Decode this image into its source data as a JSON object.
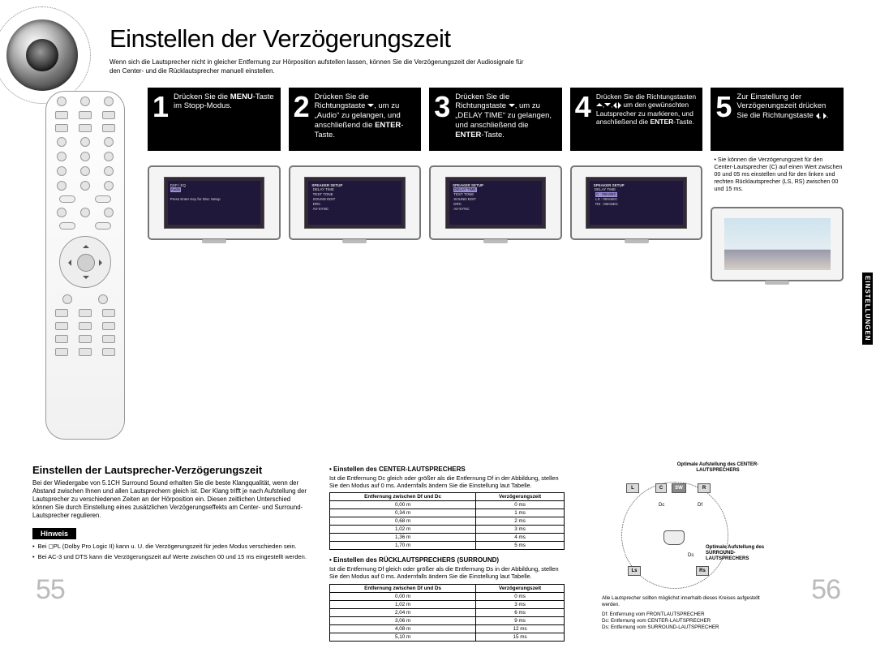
{
  "title": "Einstellen der Verzögerungszeit",
  "intro": "Wenn sich die Lautsprecher nicht in gleicher Entfernung zur Hörposition aufstellen lassen, können Sie die Verzögerungszeit der Audiosignale für den Center- und die Rücklautsprecher manuell einstellen.",
  "side_label": "EINSTELLUNGEN",
  "page_left": "55",
  "page_right": "56",
  "steps": {
    "s1": {
      "num": "1",
      "text_pre": "Drücken Sie die ",
      "bold": "MENU",
      "text_post": "-Taste im Stopp-Modus."
    },
    "s2": {
      "num": "2",
      "line1": "Drücken Sie die Richtungstaste ",
      "line2": ", um zu „Audio“ zu gelangen, und anschließend die ",
      "enter": "ENTER",
      "tail": "-Taste."
    },
    "s3": {
      "num": "3",
      "line1": "Drücken Sie die Richtungstaste ",
      "line2": ", um zu „DELAY TIME“ zu gelangen, und anschließend die ",
      "enter": "ENTER",
      "tail": "-Taste."
    },
    "s4": {
      "num": "4",
      "line1": "Drücken Sie die Richtungstasten ",
      "line2": " um den gewünschten Lautsprecher zu markieren, und anschließend die ",
      "enter": "ENTER",
      "tail": "-Taste."
    },
    "s5": {
      "num": "5",
      "text": "Zur Einstellung der Verzögerungszeit drücken Sie die Richtungstaste ",
      "tail": "."
    },
    "note5": "Sie können die Verzögerungszeit für den Center-Lautsprecher (C) auf einen Wert zwischen 00 und 05 ms einstellen und für den linken und rechten Rücklautsprecher (LS, RS) zwischen 00 und 15 ms."
  },
  "tv_labels": {
    "hint": "Press Enter Key for Disc Setup",
    "menu1": "DSP / EQ",
    "audio": "Audio",
    "spk_setup": "SPEAKER SETUP",
    "delay": "DELAY TIME",
    "test": "TEST TONE",
    "sound": "SOUND EDIT",
    "drc": "DRC",
    "avsync": "AV-SYNC",
    "c": "C : 00mSEC",
    "ls": "LS : 00mSEC",
    "rs": "RS : 00mSEC"
  },
  "bottom": {
    "sub_title": "Einstellen der Lautsprecher-Verzögerungszeit",
    "sub_body": "Bei der Wiedergabe von 5.1CH Surround Sound erhalten Sie die beste Klangqualität, wenn der Abstand zwischen Ihnen und allen Lautsprechern gleich ist. Der Klang trifft je nach Aufstellung der Lautsprecher zu verschiedenen Zeiten an der Hörposition ein. Diesen zeitlichen Unterschied können Sie durch Einstellung eines zusätzlichen Verzögerungseffekts am Center- und Surround-Lautsprecher regulieren.",
    "hinweis": "Hinweis",
    "hin1": "Bei  ◻PL (Dolby Pro Logic II) kann u. U. die Verzögerungszeit für jeden Modus verschieden sein.",
    "hin2": "Bei AC-3 und DTS kann die Verzögerungszeit auf Werte zwischen 00 und 15 ms eingestellt werden.",
    "center_h": "• Einstellen des CENTER-LAUTSPRECHERS",
    "center_p": "Ist die Entfernung Dc gleich oder größer als die Entfernung Df in der Abbildung, stellen Sie den Modus auf 0 ms. Andernfalls ändern Sie die Einstellung laut Tabelle.",
    "rear_h": "• Einstellen des RÜCKLAUTSPRECHERS (SURROUND)",
    "rear_p": "Ist die Entfernung Df gleich oder größer als die Entfernung Ds in der Abbildung, stellen Sie den Modus auf 0 ms. Andernfalls ändern Sie die Einstellung laut Tabelle.",
    "th_dc": "Entfernung zwischen Df und Dc",
    "th_ds": "Entfernung zwischen Df und Ds",
    "th_delay": "Verzögerungszeit",
    "tc": {
      "r0a": "0,00 m",
      "r0b": "0 ms",
      "r1a": "0,34 m",
      "r1b": "1 ms",
      "r2a": "0,68 m",
      "r2b": "2 ms",
      "r3a": "1,02 m",
      "r3b": "3 ms",
      "r4a": "1,36 m",
      "r4b": "4 ms",
      "r5a": "1,70 m",
      "r5b": "5 ms"
    },
    "ts": {
      "r0a": "0,00 m",
      "r0b": "0 ms",
      "r1a": "1,02 m",
      "r1b": "3 ms",
      "r2a": "2,04 m",
      "r2b": "6 ms",
      "r3a": "3,06 m",
      "r3b": "9 ms",
      "r4a": "4,08 m",
      "r4b": "12 ms",
      "r5a": "5,10 m",
      "r5b": "15 ms"
    },
    "diag": {
      "t1": "Optimale Aufstellung des CENTER-LAUTSPRECHERS",
      "t2": "Optimale Aufstellung des SURROUND-LAUTSPRECHERS",
      "L": "L",
      "C": "C",
      "SW": "SW",
      "R": "R",
      "Ls": "Ls",
      "Rs": "Rs",
      "Dc": "Dc",
      "Df": "Df",
      "Ds": "Ds",
      "foot_note": "Alle Lautsprecher sollten möglichst innerhalb dieses Kreises aufgestellt werden.",
      "k1": "Df: Entfernung vom FRONTLAUTSPRECHER",
      "k2": "Dc: Entfernung vom CENTER-LAUTSPRECHER",
      "k3": "Ds: Entfernung vom SURROUND-LAUTSPRECHER"
    }
  }
}
